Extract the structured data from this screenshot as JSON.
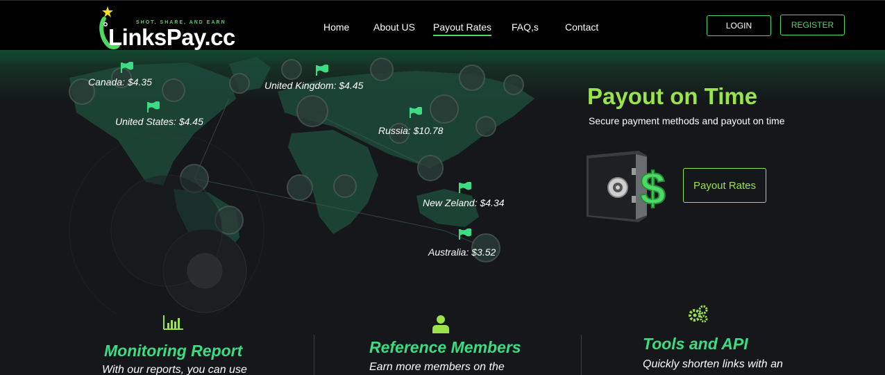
{
  "header": {
    "logo_text": "LinksPay.cc",
    "logo_tagline": "SHOT, SHARE, AND EARN",
    "nav": [
      {
        "label": "Home"
      },
      {
        "label": "About US"
      },
      {
        "label": "Payout Rates"
      },
      {
        "label": "FAQ,s"
      },
      {
        "label": "Contact"
      }
    ],
    "active_nav": "Payout Rates",
    "login_label": "LOGIN",
    "register_label": "REGISTER"
  },
  "hero": {
    "countries": [
      {
        "label": "Canada: $4.35"
      },
      {
        "label": "United Kingdom: $4.45"
      },
      {
        "label": "United States: $4.45"
      },
      {
        "label": "Russia: $10.78"
      },
      {
        "label": "New Zeland: $4.34"
      },
      {
        "label": "Australia: $3.52"
      }
    ],
    "title": "Payout on Time",
    "subtitle": "Secure payment methods and payout on time",
    "payout_button": "Payout Rates"
  },
  "features": [
    {
      "title": "Monitoring Report",
      "text": "With our reports, you can use",
      "icon": "bar-chart-icon"
    },
    {
      "title": "Reference Members",
      "text": "Earn more members on the",
      "icon": "user-icon"
    },
    {
      "title": "Tools and API",
      "text": "Quickly shorten links with an",
      "icon": "gears-icon"
    }
  ],
  "colors": {
    "accent_green": "#4cd964",
    "title_lime": "#9be34a",
    "feature_green": "#3ddc84",
    "background": "#15171a"
  }
}
